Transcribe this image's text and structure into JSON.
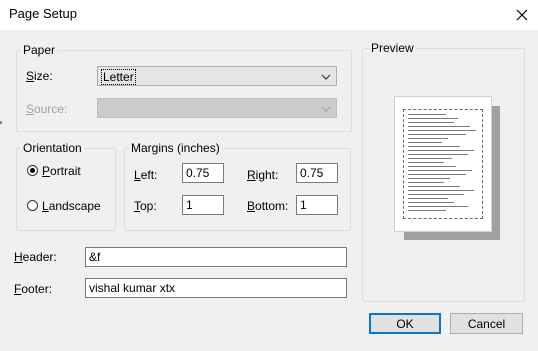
{
  "dialog": {
    "title": "Page Setup",
    "close_icon": "close-icon"
  },
  "paper": {
    "legend": "Paper",
    "size_label": "Size:",
    "size_value": "Letter",
    "source_label": "Source:",
    "source_value": ""
  },
  "orientation": {
    "legend": "Orientation",
    "options": [
      {
        "label": "Portrait",
        "selected": true
      },
      {
        "label": "Landscape",
        "selected": false
      }
    ]
  },
  "margins": {
    "legend": "Margins (inches)",
    "left_label": "Left:",
    "left_value": "0.75",
    "right_label": "Right:",
    "right_value": "0.75",
    "top_label": "Top:",
    "top_value": "1",
    "bottom_label": "Bottom:",
    "bottom_value": "1"
  },
  "header": {
    "label": "Header:",
    "value": "&f"
  },
  "footer": {
    "label": "Footer:",
    "value": "vishal kumar xtx"
  },
  "preview": {
    "legend": "Preview"
  },
  "buttons": {
    "ok": "OK",
    "cancel": "Cancel"
  },
  "colors": {
    "default_button_border": "#0078d7",
    "dialog_bg": "#f0f0f0"
  }
}
